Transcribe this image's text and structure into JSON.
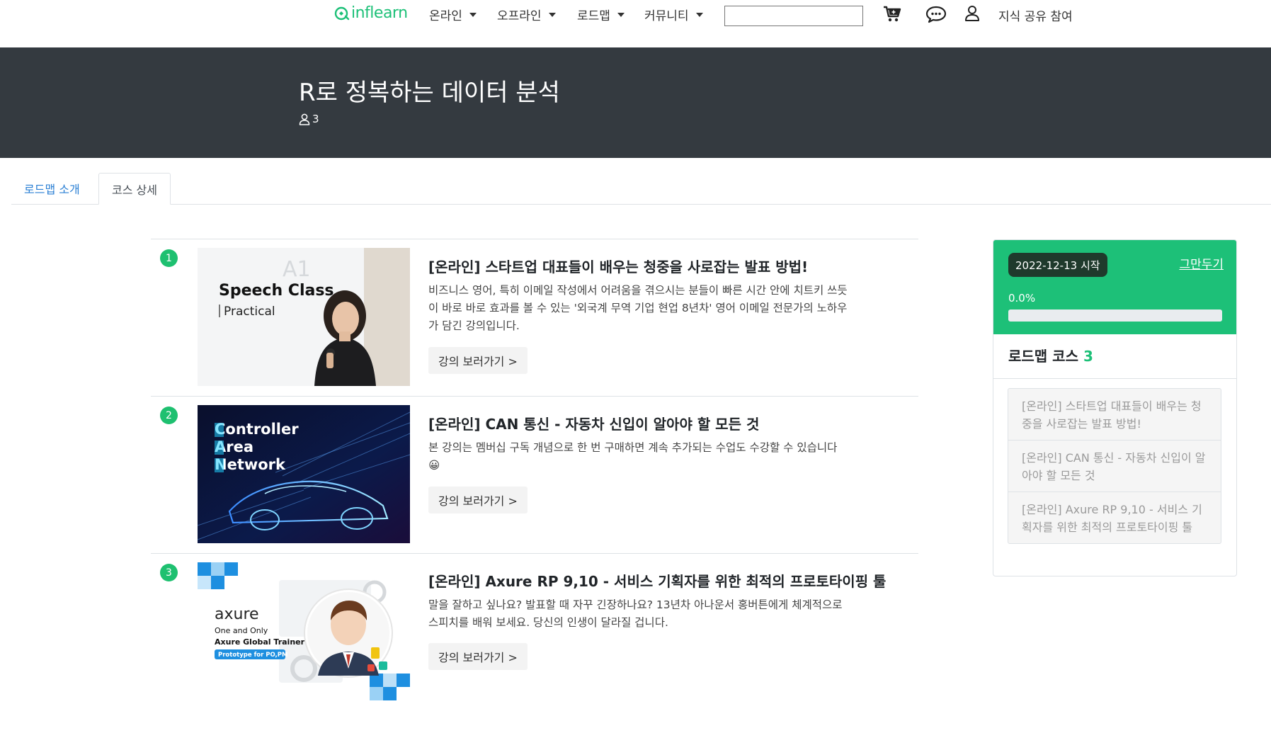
{
  "nav": {
    "logo_text": "inflearn",
    "brand_color": "#1dc078",
    "menus": [
      {
        "label": "온라인"
      },
      {
        "label": "오프라인"
      },
      {
        "label": "로드맵"
      },
      {
        "label": "커뮤니티"
      }
    ],
    "search_value": "",
    "icons": [
      "cart-icon",
      "chat-icon",
      "user-icon"
    ],
    "share_label": "지식 공유 참여"
  },
  "hero": {
    "title": "R로 정복하는 데이터 분석",
    "member_count": "3"
  },
  "tabs": [
    {
      "label": "로드맵 소개",
      "active": false
    },
    {
      "label": "코스 상세",
      "active": true
    }
  ],
  "courses": [
    {
      "number": "1",
      "title": "[온라인] 스타트업 대표들이 배우는 청중을 사로잡는 발표 방법!",
      "desc_lines": [
        "비즈니스 영어, 특히 이메일 작성에서 어려움을 겪으시는 분들이 빠른 시간 안에 치트키 쓰듯",
        "이 바로 바로 효과를 볼 수 있는 '외국계 무역 기업 현업 8년차' 영어 이메일 전문가의 노하우",
        "가 담긴 강의입니다."
      ],
      "button_label": "강의 보러가기 >",
      "thumb": {
        "line1": "Speech Class",
        "line2": "Practical",
        "watermark": "A1"
      }
    },
    {
      "number": "2",
      "title": "[온라인] CAN 통신 - 자동차 신입이 알아야 할 모든 것",
      "desc_lines": [
        "본 강의는 멤버십 구독 개념으로 한 번 구매하면 계속 추가되는 수업도 수강할 수 있습니다",
        "😀"
      ],
      "button_label": "강의 보러가기 >",
      "thumb": {
        "line1": "Controller",
        "line2": "Area",
        "line3": "Network"
      }
    },
    {
      "number": "3",
      "title": "[온라인] Axure RP 9,10 - 서비스 기획자를 위한 최적의 프로토타이핑 툴",
      "desc_lines": [
        "말을 잘하고 싶나요? 발표할 때 자꾸 긴장하나요? 13년차 아나운서 홍버튼에게 체계적으로",
        "스피치를 배워 보세요. 당신의 인생이 달라질 겁니다."
      ],
      "button_label": "강의 보러가기 >",
      "thumb": {
        "brand": "axure",
        "line1": "One and Only",
        "line2": "Axure Global Trainer",
        "tag": "Prototype for PO,PM"
      }
    }
  ],
  "sidebar": {
    "start_label": "2022-12-13 시작",
    "quit_label": "그만두기",
    "progress_text": "0.0%",
    "progress_value": 0.0,
    "heading": "로드맵 코스",
    "count": "3",
    "items": [
      {
        "label": "[온라인] 스타트업 대표들이 배우는 청중을 사로잡는 발표 방법!"
      },
      {
        "label": "[온라인] CAN 통신 - 자동차 신입이 알아야 할 모든 것"
      },
      {
        "label": "[온라인] Axure RP 9,10 - 서비스 기획자를 위한 최적의 프로토타이핑 툴"
      }
    ]
  }
}
